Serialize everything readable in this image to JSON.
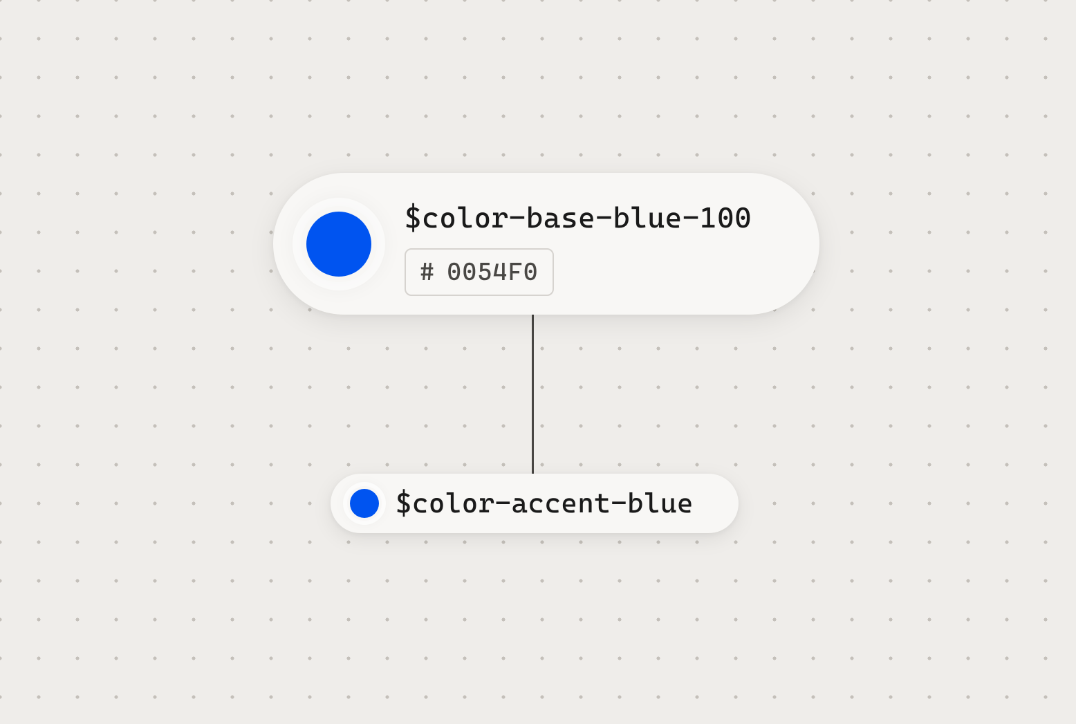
{
  "tokens": {
    "base": {
      "name": "$color-base-blue-100",
      "hex_prefix": "#",
      "hex_value": "0054F0",
      "swatch_color": "#0054F0"
    },
    "alias": {
      "name": "$color-accent-blue",
      "swatch_color": "#0054F0"
    }
  }
}
